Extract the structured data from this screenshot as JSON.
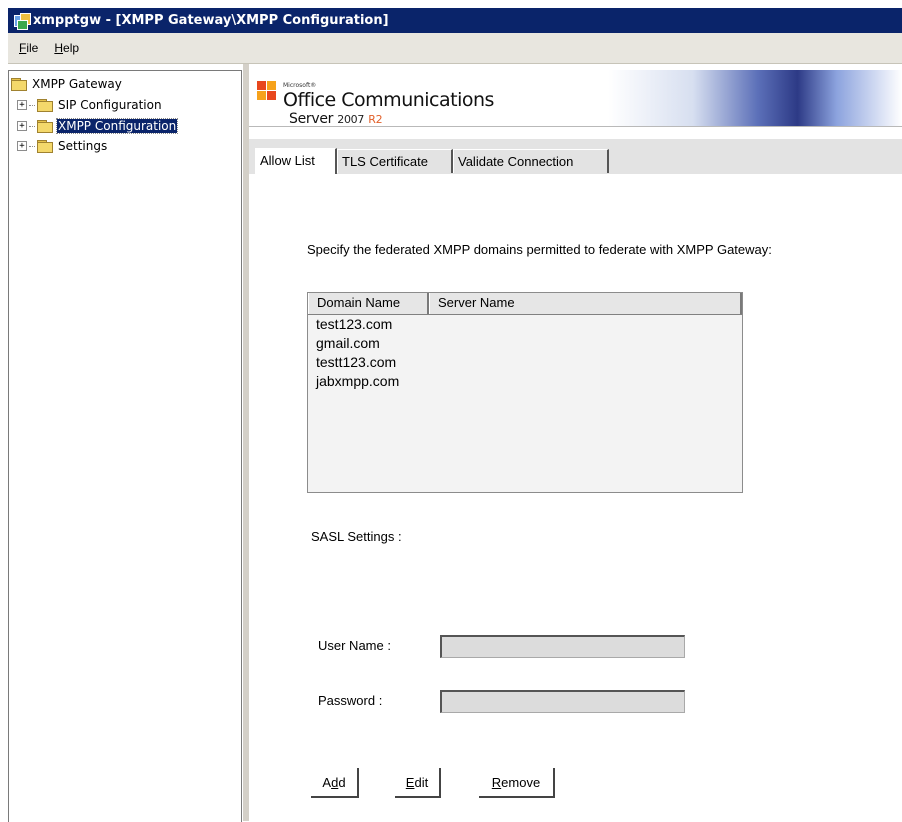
{
  "window": {
    "title": "xmpptgw - [XMPP Gateway\\XMPP Configuration]"
  },
  "menu": [
    {
      "pre": "",
      "key": "F",
      "post": "ile"
    },
    {
      "pre": "",
      "key": "H",
      "post": "elp"
    }
  ],
  "tree": {
    "root": "XMPP Gateway",
    "children": [
      "SIP Configuration",
      "XMPP Configuration",
      "Settings"
    ],
    "selected": "XMPP Configuration"
  },
  "banner": {
    "microsoft": "Microsoft®",
    "line1": "Office Communications",
    "line2_prefix": "Server",
    "line2_year": "2007",
    "line2_suffix": "R2"
  },
  "tabs": [
    "Allow List",
    "TLS Certificate",
    "Validate Connection"
  ],
  "active_tab": "Allow List",
  "allow_list": {
    "instruction": "Specify the federated XMPP domains permitted to federate with XMPP Gateway:",
    "columns": [
      "Domain Name",
      "Server Name"
    ],
    "rows": [
      "test123.com",
      "gmail.com",
      "testt123.com",
      "jabxmpp.com"
    ]
  },
  "sasl": {
    "heading": "SASL Settings :",
    "username_label": "User Name :",
    "username_value": "",
    "password_label": "Password :",
    "password_value": ""
  },
  "buttons": [
    {
      "pre": "A",
      "key": "d",
      "post": "d"
    },
    {
      "pre": "",
      "key": "E",
      "post": "dit"
    },
    {
      "pre": "",
      "key": "R",
      "post": "emove"
    }
  ],
  "colors": {
    "titlebar": "#0a246a",
    "selection": "#0a246a",
    "menubar": "#e8e6df"
  }
}
